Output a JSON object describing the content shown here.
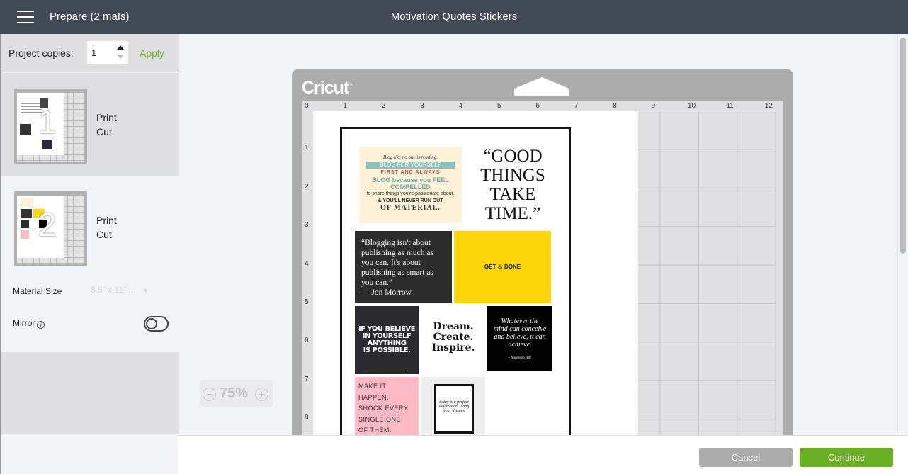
{
  "header": {
    "menu_icon": "hamburger-menu-icon",
    "prepare_title": "Prepare (2 mats)",
    "project_title": "Motivation Quotes Stickers"
  },
  "sidebar": {
    "copies_label": "Project copies:",
    "copies_value": "1",
    "apply_label": "Apply",
    "mats": [
      {
        "number": "1",
        "line1": "Print",
        "line2": "Cut",
        "selected": true
      },
      {
        "number": "2",
        "line1": "Print",
        "line2": "Cut",
        "selected": false
      }
    ],
    "material_size_label": "Material Size",
    "material_size_value": "8.5\" x 11\" ...",
    "mirror_label": "Mirror",
    "mirror_on": false
  },
  "canvas": {
    "zoom_level": "75%",
    "zoom_out_symbol": "−",
    "zoom_in_symbol": "+",
    "mat_brand": "Cricut",
    "ruler_x": [
      "0",
      "1",
      "2",
      "3",
      "4",
      "5",
      "6",
      "7",
      "8",
      "9",
      "10",
      "11",
      "12"
    ],
    "ruler_y": [
      "0",
      "1",
      "2",
      "3",
      "4",
      "5",
      "6",
      "7",
      "8"
    ],
    "stickers": {
      "blog": {
        "l1": "Blog like no one is reading.",
        "l2": "BLOG FOR YOURSELF",
        "l3": "FIRST AND ALWAYS",
        "l4": "BLOG because you FEEL COMPELLED",
        "l5": "to share things you're passionate about.",
        "l6": "& YOU'LL NEVER RUN OUT",
        "l7": "OF MATERIAL."
      },
      "good_things": [
        "“GOOD",
        "THINGS",
        "TAKE",
        "TIME.”"
      ],
      "blogging_quote": "“Blogging isn't about publishing as much as you can. It's about publishing as smart as you can.”",
      "blogging_author": "— Jon Morrow",
      "get_done": "GET ♨ DONE",
      "believe": [
        "IF YOU BELIEVE",
        "IN YOURSELF",
        "ANYTHING",
        "IS POSSIBLE."
      ],
      "dream": [
        "Dream.",
        "Create.",
        "Inspire."
      ],
      "whatever": [
        "Whatever the",
        "mind can conceive",
        "and believe, it can",
        "achieve."
      ],
      "whatever_author": "- Napoleon Hill",
      "make_it": [
        "MAKE IT",
        "HAPPEN.",
        "SHOCK EVERY",
        "SINGLE ONE",
        "OF THEM."
      ],
      "today": "today is a perfect day to start living your dreams"
    }
  },
  "footer": {
    "cancel_label": "Cancel",
    "continue_label": "Continue"
  },
  "colors": {
    "header_bg": "#414a53",
    "accent_green": "#6ab023",
    "cancel_gray": "#acacac",
    "mat_gray": "#acacac"
  }
}
